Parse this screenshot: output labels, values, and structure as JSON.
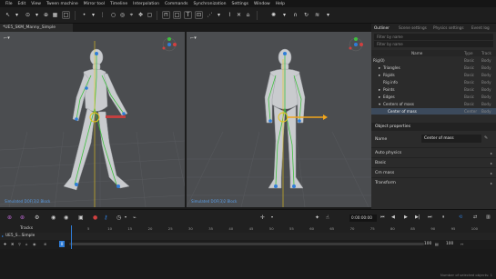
{
  "menu": [
    "File",
    "Edit",
    "View",
    "Tween machine",
    "Mirror tool",
    "Timeline",
    "Interpolation",
    "Commands",
    "Synchronization",
    "Settings",
    "Window",
    "Help"
  ],
  "document_tab": "*UE5_SKM_Manny_Simple",
  "viewports": {
    "left_label": "Simulated DOF(3)2 Block",
    "right_label": "Simulated DOF(3)2 Block",
    "cam_icon": "camera-icon"
  },
  "right_panel": {
    "tabs": [
      "Outliner",
      "Scene settings",
      "Physics settings",
      "Event log"
    ],
    "filter_placeholder": "Filter by name",
    "filter_hint": "Filter by name",
    "columns": {
      "name": "Name",
      "type": "Type",
      "track": "Track"
    },
    "tree": [
      {
        "name": "Rig(0)",
        "type": "Basic",
        "track": "Body"
      },
      {
        "name": "Triangles",
        "type": "Basic",
        "track": "Body"
      },
      {
        "name": "Rigids",
        "type": "Basic",
        "track": "Body"
      },
      {
        "name": "Rig info",
        "type": "Basic",
        "track": "Body"
      },
      {
        "name": "Points",
        "type": "Basic",
        "track": "Body"
      },
      {
        "name": "Edges",
        "type": "Basic",
        "track": "Body"
      },
      {
        "name": "Centers of mass",
        "type": "Basic",
        "track": "Body"
      },
      {
        "name": "Center of mass",
        "type": "Center",
        "track": "Body"
      }
    ],
    "object_properties_title": "Object properties",
    "name_label": "Name",
    "name_value": "Center of mass",
    "sections": [
      "Auto physics",
      "Basic",
      "Cm mass",
      "Transform"
    ]
  },
  "playback": {
    "time": "0:00:00:00",
    "frame": "0"
  },
  "timeline": {
    "tracks_label": "Tracks",
    "track_name": "UE5_S...Simple",
    "frame_start": "0",
    "frame_end": "100",
    "range_end": "100",
    "ruler": [
      "5",
      "10",
      "15",
      "20",
      "25",
      "30",
      "35",
      "40",
      "45",
      "50",
      "55",
      "60",
      "65",
      "70",
      "75",
      "80",
      "85",
      "90",
      "95",
      "100"
    ],
    "status": "Number of selected objects: 1"
  },
  "colors": {
    "accent_blue": "#2f7dd8",
    "selection": "#3c4a5c",
    "gizmo_yellow": "#e8c61b",
    "bone_green": "#3fbf3f"
  }
}
